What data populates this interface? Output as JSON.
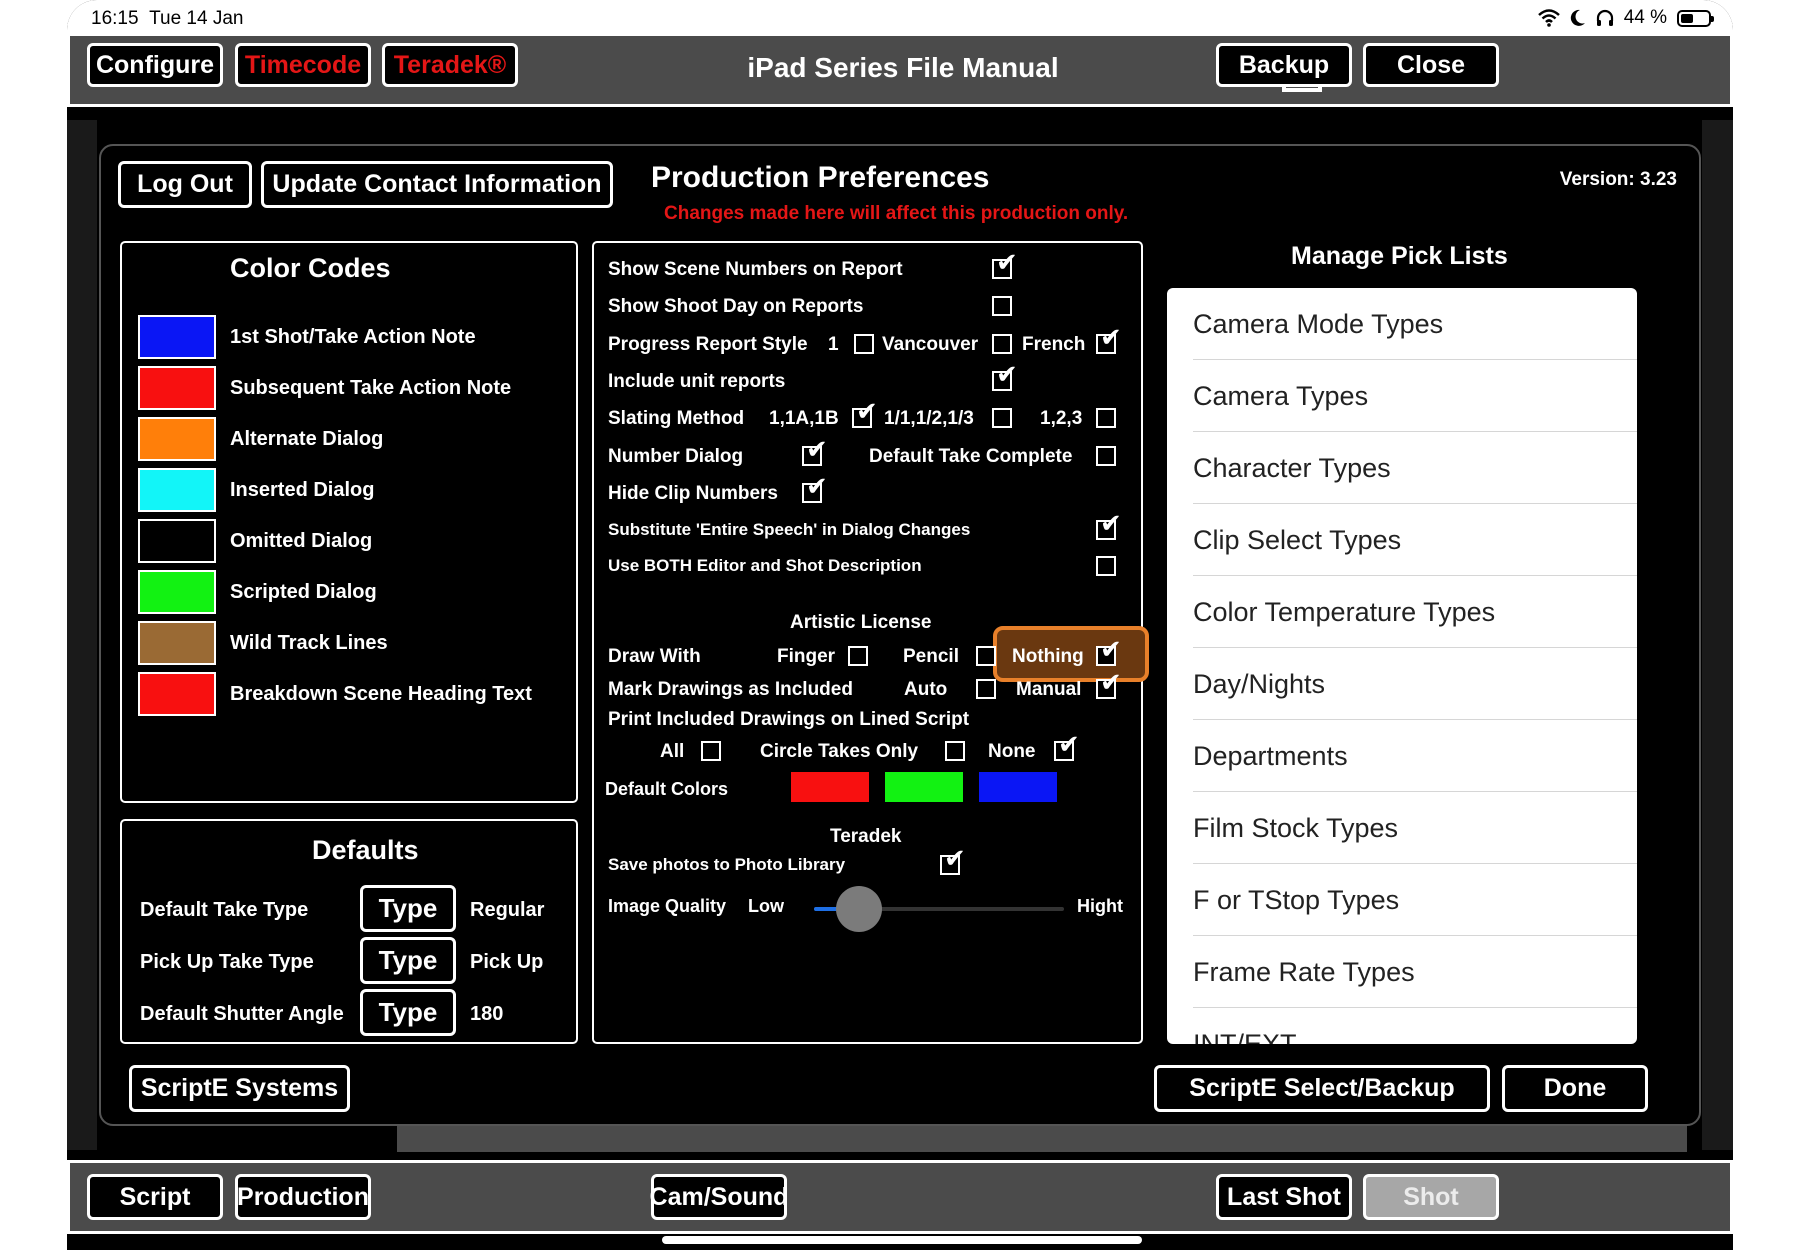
{
  "status": {
    "time": "16:15",
    "date": "Tue 14 Jan",
    "battery": "44 %"
  },
  "topbar": {
    "title": "iPad Series File Manual",
    "configure": "Configure",
    "timecode": "Timecode",
    "teradek": "Teradek®",
    "backup": "Backup",
    "close": "Close",
    "share_icon": "share-icon"
  },
  "modal": {
    "log_out": "Log Out",
    "update_contact": "Update Contact Information",
    "title": "Production Preferences",
    "warning": "Changes made here will affect this production only.",
    "version": "Version: 3.23",
    "scripte_systems": "ScriptE Systems",
    "scripte_select_backup": "ScriptE Select/Backup",
    "done": "Done"
  },
  "color_codes": {
    "title": "Color Codes",
    "items": [
      {
        "label": "1st Shot/Take Action Note",
        "color": "#0a16f5"
      },
      {
        "label": "Subsequent Take Action Note",
        "color": "#f81010"
      },
      {
        "label": "Alternate Dialog",
        "color": "#ff7f0a"
      },
      {
        "label": "Inserted Dialog",
        "color": "#12f5f8"
      },
      {
        "label": "Omitted Dialog",
        "color": "#000000"
      },
      {
        "label": "Scripted Dialog",
        "color": "#12f212"
      },
      {
        "label": "Wild Track Lines",
        "color": "#9a6a34"
      },
      {
        "label": "Breakdown Scene Heading Text",
        "color": "#f81010"
      }
    ]
  },
  "defaults": {
    "title": "Defaults",
    "rows": [
      {
        "label": "Default Take Type",
        "button": "Type",
        "value": "Regular"
      },
      {
        "label": "Pick Up Take Type",
        "button": "Type",
        "value": "Pick Up"
      },
      {
        "label": "Default Shutter Angle",
        "button": "Type",
        "value": "180"
      }
    ]
  },
  "options": {
    "show_scene_numbers": "Show Scene Numbers on Report",
    "show_shoot_day": "Show Shoot Day on Reports",
    "progress_report_style": "Progress Report Style",
    "prs_1": "1",
    "prs_vancouver": "Vancouver",
    "prs_french": "French",
    "include_unit_reports": "Include unit reports",
    "slating_method": "Slating Method",
    "sm_1": "1,1A,1B",
    "sm_2": "1/1,1/2,1/3",
    "sm_3": "1,2,3",
    "number_dialog": "Number Dialog",
    "default_take_complete": "Default Take Complete",
    "hide_clip_numbers": "Hide Clip Numbers",
    "substitute_entire_speech": "Substitute 'Entire Speech' in Dialog Changes",
    "use_both_editor": "Use BOTH Editor and Shot Description",
    "artistic_license": "Artistic License",
    "draw_with": "Draw With",
    "finger": "Finger",
    "pencil": "Pencil",
    "nothing": "Nothing",
    "mark_drawings": "Mark Drawings as Included",
    "auto": "Auto",
    "manual": "Manual",
    "print_included": "Print Included Drawings on Lined Script",
    "all": "All",
    "circle_takes_only": "Circle Takes Only",
    "none": "None",
    "default_colors": "Default Colors",
    "default_color_values": [
      "#f81010",
      "#12f212",
      "#0a16f5"
    ],
    "teradek": "Teradek",
    "save_photos": "Save photos to Photo Library",
    "image_quality": "Image Quality",
    "low": "Low",
    "high": "Hight",
    "image_quality_level": 0.18
  },
  "pick_lists": {
    "title": "Manage Pick Lists",
    "items": [
      "Camera Mode Types",
      "Camera Types",
      "Character Types",
      "Clip Select Types",
      "Color Temperature Types",
      "Day/Nights",
      "Departments",
      "Film Stock Types",
      "F or TStop Types",
      "Frame Rate Types",
      "INT/EXT"
    ]
  },
  "bottombar": {
    "script": "Script",
    "production": "Production",
    "cam_sound": "Cam/Sound",
    "last_shot": "Last Shot",
    "shot": "Shot"
  }
}
